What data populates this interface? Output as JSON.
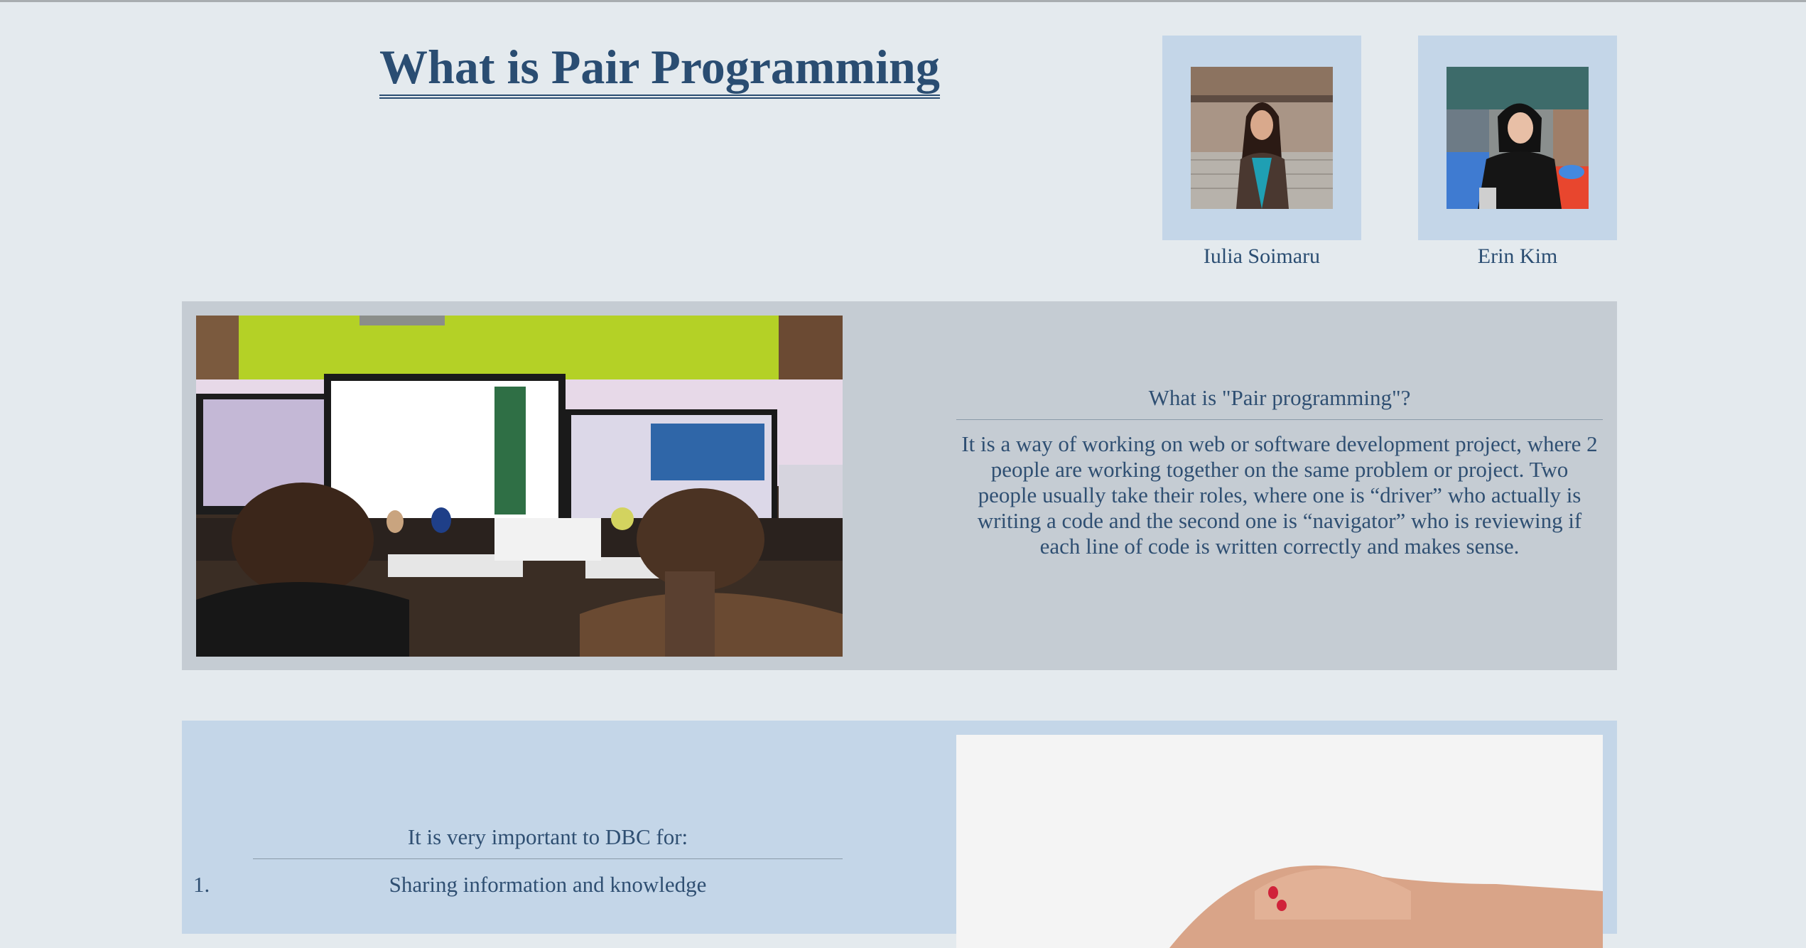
{
  "page": {
    "title": "What is Pair Programming"
  },
  "profiles": [
    {
      "name": "Iulia Soimaru"
    },
    {
      "name": "Erin Kim"
    }
  ],
  "section_intro": {
    "question": "What is \"Pair programming\"?",
    "body": "It is a way of working on web or software development project, where 2 people are working together on the same problem or project. Two people usually take their roles, where one is “driver” who actually is writing a code and the second one is “navigator” who is reviewing if each line of code is written correctly and makes sense."
  },
  "section_importance": {
    "heading": "It is very important to DBC for:",
    "items": [
      {
        "number": "1.",
        "text": "Sharing information and knowledge"
      }
    ]
  },
  "colors": {
    "page_bg": "#e4eaee",
    "text": "#2a4d72",
    "panel_gray": "#c5ccd3",
    "panel_blue": "#c4d6e8"
  }
}
